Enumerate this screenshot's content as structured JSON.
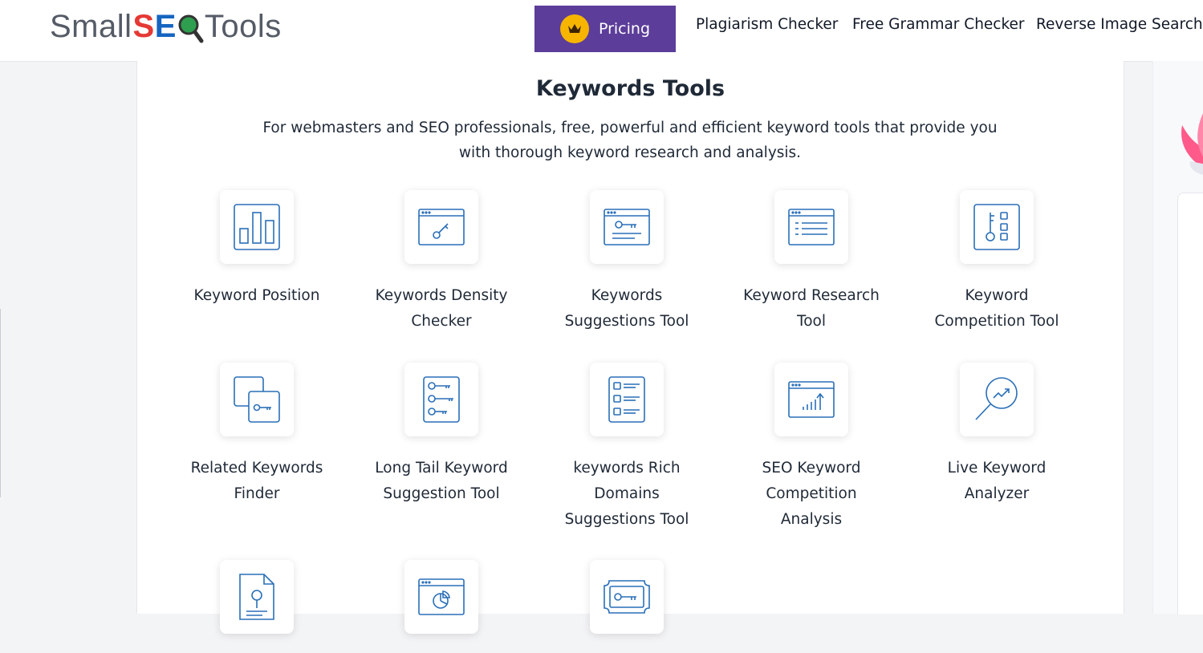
{
  "header": {
    "logo": {
      "prefix": "Small",
      "seo_s": "S",
      "seo_e": "E",
      "suffix": "Tools"
    },
    "pricing_label": "Pricing",
    "nav": [
      "Plagiarism Checker",
      "Free Grammar Checker",
      "Reverse Image Search"
    ]
  },
  "main": {
    "title": "Keywords Tools",
    "description": "For webmasters and SEO professionals, free, powerful and efficient keyword tools that provide you with thorough keyword research and analysis.",
    "tools": [
      {
        "label": "Keyword Position",
        "icon": "bar-chart-icon"
      },
      {
        "label": "Keywords Density Checker",
        "icon": "browser-key-icon"
      },
      {
        "label": "Keywords Suggestions Tool",
        "icon": "browser-key-list-icon"
      },
      {
        "label": "Keyword Research Tool",
        "icon": "browser-list-icon"
      },
      {
        "label": "Keyword Competition Tool",
        "icon": "key-grid-icon"
      },
      {
        "label": "Related Keywords Finder",
        "icon": "overlapping-windows-key-icon"
      },
      {
        "label": "Long Tail Keyword Suggestion Tool",
        "icon": "multi-key-list-icon"
      },
      {
        "label": "keywords Rich Domains Suggestions Tool",
        "icon": "checklist-icon"
      },
      {
        "label": "SEO Keyword Competition Analysis",
        "icon": "browser-growth-chart-icon"
      },
      {
        "label": "Live Keyword Analyzer",
        "icon": "magnifier-trend-icon"
      },
      {
        "label": "",
        "icon": "document-pin-icon"
      },
      {
        "label": "",
        "icon": "browser-pie-chart-icon"
      },
      {
        "label": "",
        "icon": "key-ticket-icon"
      }
    ]
  },
  "colors": {
    "accent": "#5c3d99",
    "icon_stroke": "#2a6fb8",
    "crown": "#f7b500"
  }
}
